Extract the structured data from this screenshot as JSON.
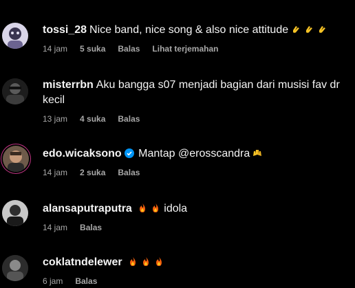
{
  "comments": [
    {
      "username": "tossi_28",
      "text": "Nice band, nice song & also nice attitude",
      "emoji": [
        "clapping-hands-emoji",
        "clapping-hands-emoji",
        "clapping-hands-emoji"
      ],
      "time": "14 jam",
      "likes": "5 suka",
      "reply": "Balas",
      "translate": "Lihat terjemahan"
    },
    {
      "username": "misterrbn",
      "text": "Aku bangga s07 menjadi bagian dari musisi fav dr kecil",
      "time": "13 jam",
      "likes": "4 suka",
      "reply": "Balas"
    },
    {
      "username": "edo.wicaksono",
      "verified": true,
      "text": "Mantap @erosscandra",
      "emoji": [
        "raising-hands-emoji"
      ],
      "time": "14 jam",
      "likes": "2 suka",
      "reply": "Balas"
    },
    {
      "username": "alansaputraputra",
      "text": "idola",
      "emoji_before": [
        "fire-emoji",
        "fire-emoji"
      ],
      "time": "14 jam",
      "reply": "Balas"
    },
    {
      "username": "coklatndelewer",
      "text": "",
      "emoji": [
        "fire-emoji",
        "fire-emoji",
        "fire-emoji"
      ],
      "time": "6 jam",
      "reply": "Balas"
    }
  ],
  "colors": {
    "background": "#000000",
    "text": "#f5f5f5",
    "meta": "#a8a8a8",
    "verified": "#0095f6",
    "story_ring": "#c13584"
  }
}
